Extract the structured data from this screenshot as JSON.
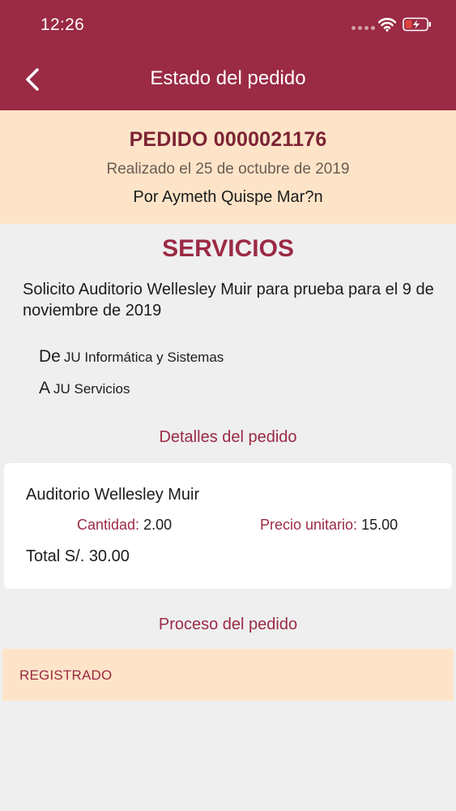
{
  "status_bar": {
    "time": "12:26"
  },
  "nav": {
    "title": "Estado del pedido"
  },
  "order": {
    "number": "PEDIDO 0000021176",
    "date": "Realizado el 25 de octubre de 2019",
    "by": "Por Aymeth  Quispe Mar?n"
  },
  "section": {
    "title": "SERVICIOS",
    "description": "Solicito Auditorio Wellesley Muir para prueba para el 9 de noviembre de 2019",
    "from_label": "De",
    "from_value": "JU Informática y Sistemas",
    "to_label": "A",
    "to_value": "JU Servicios"
  },
  "details": {
    "heading": "Detalles del pedido",
    "item": {
      "name": "Auditorio Wellesley Muir",
      "quantity_label": "Cantidad:",
      "quantity_value": "2.00",
      "price_label": "Precio unitario:",
      "price_value": "15.00",
      "total": "Total S/. 30.00"
    }
  },
  "process": {
    "heading": "Proceso del pedido",
    "status": "REGISTRADO"
  },
  "colors": {
    "brand": "#9b2a44",
    "header_bg": "#fde4c8",
    "page_bg": "#efeff0",
    "battery_accent": "#e0453f"
  }
}
